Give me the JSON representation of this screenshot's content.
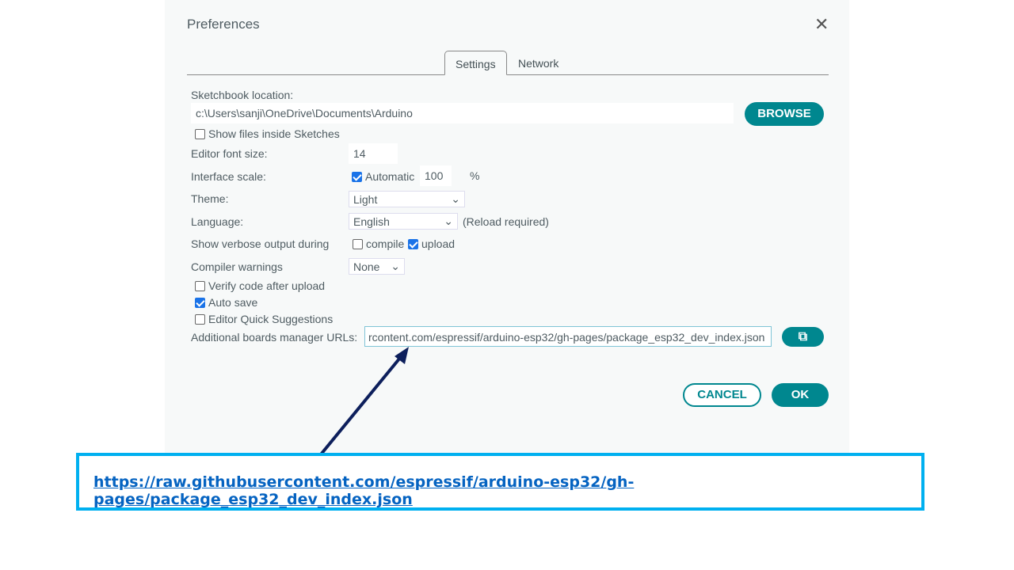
{
  "dialog": {
    "title": "Preferences",
    "close_icon": "close-icon",
    "tabs": [
      {
        "label": "Settings",
        "active": true
      },
      {
        "label": "Network",
        "active": false
      }
    ],
    "sketchbook_label": "Sketchbook location:",
    "sketchbook_value": "c:\\Users\\sanji\\OneDrive\\Documents\\Arduino",
    "browse": "BROWSE",
    "show_files": "Show files inside Sketches",
    "show_files_checked": false,
    "font_size_label": "Editor font size:",
    "font_size": "14",
    "scale_label": "Interface scale:",
    "automatic": "Automatic",
    "automatic_checked": true,
    "scale": "100",
    "percent": "%",
    "theme_label": "Theme:",
    "theme": "Light",
    "language_label": "Language:",
    "language": "English",
    "reload": "(Reload required)",
    "verbose_label": "Show verbose output during",
    "compile": "compile",
    "compile_checked": false,
    "upload": "upload",
    "upload_checked": true,
    "warnings_label": "Compiler warnings",
    "warnings": "None",
    "verify": "Verify code after upload",
    "verify_checked": false,
    "autosave": "Auto save",
    "autosave_checked": true,
    "quick": "Editor Quick Suggestions",
    "quick_checked": false,
    "urls_label": "Additional boards manager URLs:",
    "urls_value": "rcontent.com/espressif/arduino-esp32/gh-pages/package_esp32_dev_index.json",
    "cancel": "CANCEL",
    "ok": "OK"
  },
  "callout": {
    "url": "https://raw.githubusercontent.com/espressif/arduino-esp32/gh-pages/package_esp32_dev_index.json",
    "border_color": "#00b0f0",
    "arrow_color": "#0d1f5c"
  },
  "colors": {
    "accent": "#00878f"
  }
}
